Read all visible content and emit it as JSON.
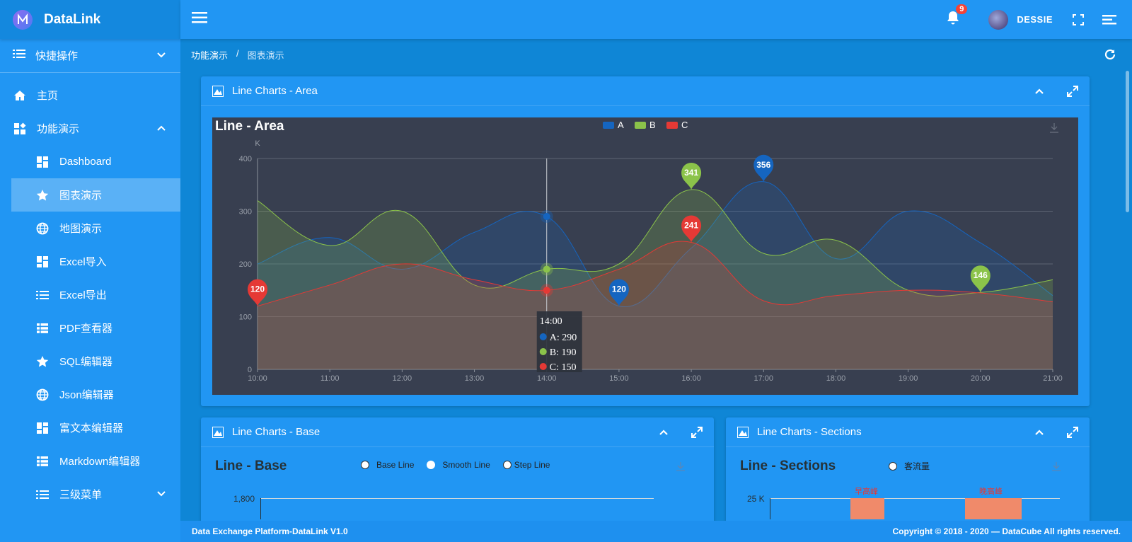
{
  "app": {
    "name": "DataLink"
  },
  "sidebar": {
    "quick_label": "快捷操作",
    "items": [
      {
        "label": "主页",
        "icon": "home-icon"
      },
      {
        "label": "功能演示",
        "icon": "widgets-icon"
      },
      {
        "label": "Dashboard",
        "icon": "dashboard-icon"
      },
      {
        "label": "图表演示",
        "icon": "star-icon"
      },
      {
        "label": "地图演示",
        "icon": "globe-icon"
      },
      {
        "label": "Excel导入",
        "icon": "dashboard-icon"
      },
      {
        "label": "Excel导出",
        "icon": "list-icon"
      },
      {
        "label": "PDF查看器",
        "icon": "table-icon"
      },
      {
        "label": "SQL编辑器",
        "icon": "star-icon"
      },
      {
        "label": "Json编辑器",
        "icon": "globe-icon"
      },
      {
        "label": "富文本编辑器",
        "icon": "dashboard-icon"
      },
      {
        "label": "Markdown编辑器",
        "icon": "table-icon"
      },
      {
        "label": "三级菜单",
        "icon": "list-icon"
      }
    ]
  },
  "header": {
    "notifications": "9",
    "username": "DESSIE"
  },
  "breadcrumb": {
    "parent": "功能演示",
    "separator": "/",
    "current": "图表演示"
  },
  "panel_area": {
    "header_title": "Line Charts - Area"
  },
  "panel_base": {
    "header_title": "Line Charts - Base",
    "chart_title": "Line - Base",
    "legend": [
      "Base Line",
      "Smooth Line",
      "Step Line"
    ],
    "y_tick": "1,800"
  },
  "panel_sections": {
    "header_title": "Line Charts - Sections",
    "chart_title": "Line - Sections",
    "legend": [
      "客流量"
    ],
    "y_tick": "25 K",
    "markers": [
      "早高峰",
      "晚高峰"
    ]
  },
  "footer": {
    "left": "Data Exchange Platform-DataLink V1.0",
    "right": "Copyright © 2018 - 2020 — DataCube All rights reserved."
  },
  "chart_data": {
    "type": "area",
    "title": "Line - Area",
    "ylabel": "K",
    "x": [
      "10:00",
      "11:00",
      "12:00",
      "13:00",
      "14:00",
      "15:00",
      "16:00",
      "17:00",
      "18:00",
      "19:00",
      "20:00",
      "21:00"
    ],
    "ylim": [
      0,
      400
    ],
    "yticks": [
      0,
      100,
      200,
      300,
      400
    ],
    "series": [
      {
        "name": "A",
        "color": "#1565c0",
        "values": [
          200,
          250,
          190,
          260,
          290,
          120,
          230,
          356,
          210,
          300,
          240,
          140
        ]
      },
      {
        "name": "B",
        "color": "#8bc34a",
        "values": [
          320,
          235,
          300,
          160,
          190,
          200,
          341,
          220,
          245,
          150,
          146,
          170
        ]
      },
      {
        "name": "C",
        "color": "#e53935",
        "values": [
          120,
          160,
          200,
          170,
          150,
          190,
          241,
          130,
          140,
          150,
          145,
          128
        ]
      }
    ],
    "markers": [
      {
        "series": "A",
        "label": "356",
        "x": "17:00",
        "y": 356
      },
      {
        "series": "A",
        "label": "120",
        "x": "15:00",
        "y": 120
      },
      {
        "series": "B",
        "label": "341",
        "x": "16:00",
        "y": 341
      },
      {
        "series": "B",
        "label": "146",
        "x": "20:00",
        "y": 146
      },
      {
        "series": "C",
        "label": "241",
        "x": "16:00",
        "y": 241
      },
      {
        "series": "C",
        "label": "120",
        "x": "10:00",
        "y": 120
      }
    ],
    "tooltip": {
      "x": "14:00",
      "lines": [
        "A: 290",
        "B: 190",
        "C: 150"
      ]
    },
    "legend_position": "top-center",
    "grid": true
  }
}
